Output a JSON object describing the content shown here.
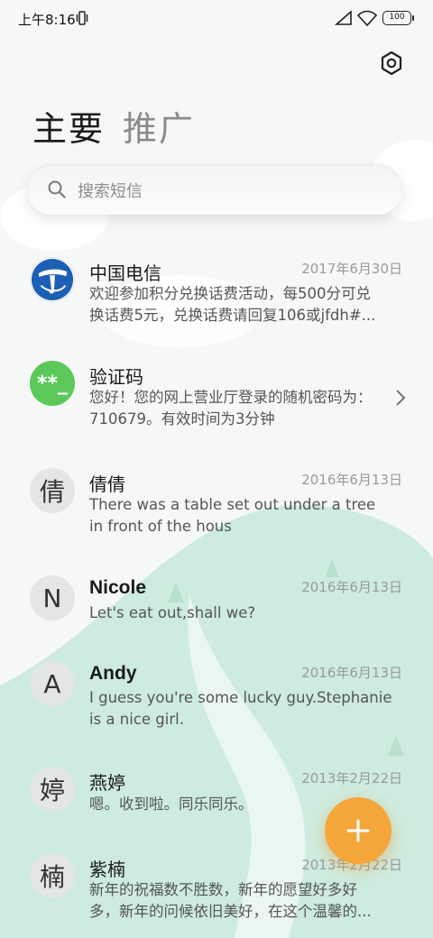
{
  "status": {
    "time": "上午8:16",
    "battery": "100"
  },
  "tabs": [
    {
      "label": "主要",
      "active": true
    },
    {
      "label": "推广",
      "active": false
    }
  ],
  "search": {
    "placeholder": "搜索短信"
  },
  "icons": {
    "settings": "gear-icon",
    "search": "search-icon",
    "add": "plus-icon",
    "chevron": "chevron-right-icon"
  },
  "colors": {
    "fab": "#f5a63a",
    "green_avatar": "#5cc85a",
    "telecom_blue": "#1d5fb4"
  },
  "messages": [
    {
      "avatar": "",
      "avatar_type": "telecom",
      "name": "中国电信",
      "date": "2017年6月30日",
      "preview_line1": "欢迎参加积分兑换话费活动，每500分可兑",
      "preview_line2": "换话费5元，兑换话费请回复106或jfdh#..."
    },
    {
      "avatar": "**_",
      "avatar_type": "green",
      "name": "验证码",
      "date": "",
      "preview_line1": "您好！您的网上营业厅登录的随机密码为：",
      "preview_line2": "710679。有效时间为3分钟"
    },
    {
      "avatar": "倩",
      "avatar_type": "letter",
      "name": "倩倩",
      "date": "2016年6月13日",
      "preview_line1": "There was a table set out under a tree",
      "preview_line2": "in front of the hous"
    },
    {
      "avatar": "N",
      "avatar_type": "letter",
      "name": "Nicole",
      "date": "2016年6月13日",
      "preview_line1": "Let's eat out,shall we?",
      "preview_line2": ""
    },
    {
      "avatar": "A",
      "avatar_type": "letter",
      "name": "Andy",
      "date": "2016年6月13日",
      "preview_line1": "I guess you're some lucky guy.Stephanie",
      "preview_line2": "is a nice girl."
    },
    {
      "avatar": "婷",
      "avatar_type": "letter",
      "name": "燕婷",
      "date": "2013年2月22日",
      "preview_line1": "嗯。收到啦。同乐同乐。",
      "preview_line2": ""
    },
    {
      "avatar": "楠",
      "avatar_type": "letter",
      "name": "紫楠",
      "date": "2013年2月22日",
      "preview_line1": "新年的祝福数不胜数，新年的愿望好多好",
      "preview_line2": "多，新年的问候依旧美好，在这个温馨的..."
    }
  ]
}
